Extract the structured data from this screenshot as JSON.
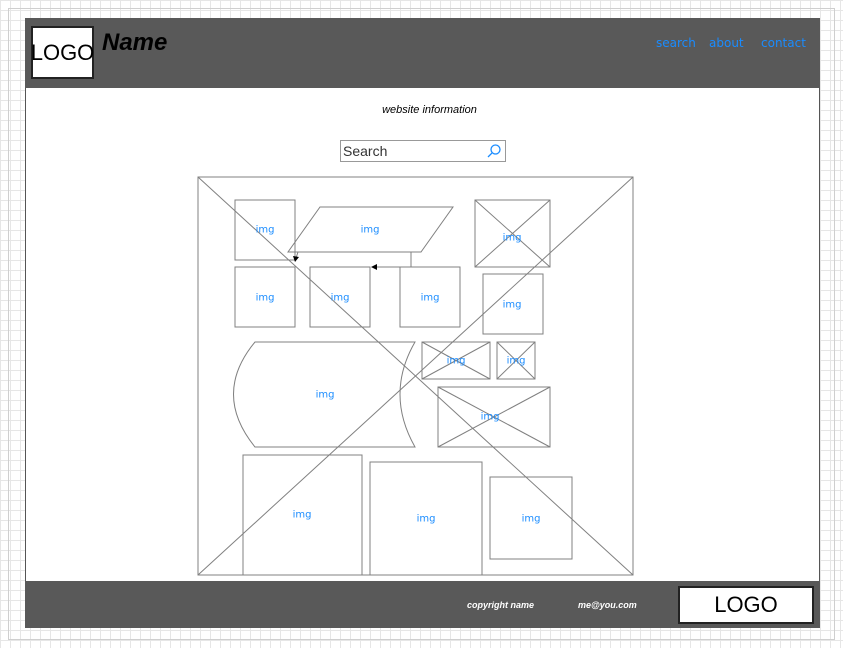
{
  "header": {
    "logo": "LOGO",
    "site_name": "Name",
    "nav": [
      {
        "label": "search"
      },
      {
        "label": "about"
      },
      {
        "label": "contact"
      }
    ]
  },
  "main": {
    "info_text": "website information",
    "search": {
      "placeholder": "Search"
    },
    "image_label": "img"
  },
  "footer": {
    "copyright": "copyright name",
    "email": "me@you.com",
    "logo": "LOGO"
  },
  "colors": {
    "bar": "#595959",
    "link": "#1a8cff",
    "outline": "#808080"
  }
}
